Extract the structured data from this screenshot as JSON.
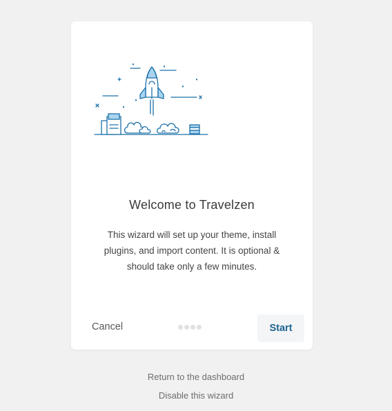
{
  "wizard": {
    "title": "Welcome to Travelzen",
    "description": "This wizard will set up your theme, install plugins, and import content. It is optional & should take only a few minutes.",
    "cancel_label": "Cancel",
    "start_label": "Start",
    "steps_total": 4,
    "current_step": 0
  },
  "footer": {
    "dashboard_link": "Return to the dashboard",
    "disable_link": "Disable this wizard"
  },
  "illustration": {
    "icon": "rocket-launch-icon"
  },
  "colors": {
    "background": "#f1f1f1",
    "card": "#ffffff",
    "accent": "#1f6491",
    "illustration_line": "#1a6fa8",
    "illustration_fill": "#a9d4ef"
  }
}
